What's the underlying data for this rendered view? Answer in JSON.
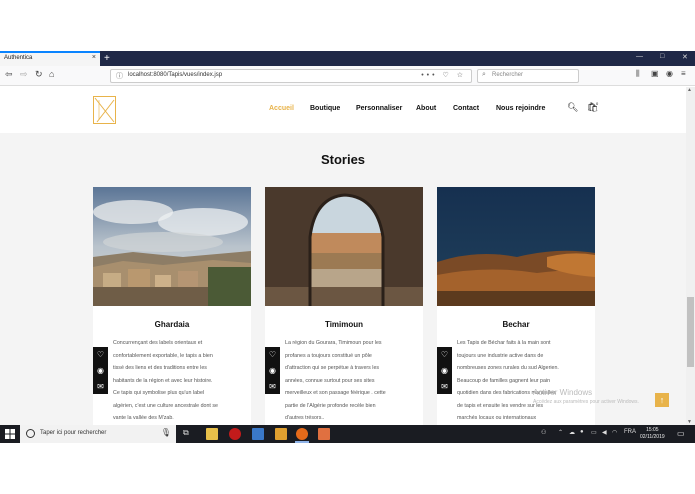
{
  "browser": {
    "tab_title": "Authentica",
    "tab_close": "×",
    "new_tab": "+",
    "window_controls": [
      "—",
      "□",
      "✕"
    ],
    "url": "localhost:8080/Tapis/vues/index.jsp",
    "url_actions": "••• ♡ ☆",
    "search_placeholder": "Rechercher"
  },
  "site": {
    "menu": [
      "Accueil",
      "Boutique",
      "Personnaliser",
      "About",
      "Contact",
      "Nous rejoindre"
    ],
    "active_menu": "Accueil",
    "cart_count": "0",
    "section_title": "Stories",
    "stories": [
      {
        "title": "Ghardaia",
        "lines": [
          "Concurrençant des labels orientaux et",
          "confortablement exportable, le tapis a bien",
          "tissé des liens et des traditions entre les",
          "habitants de la région et avec leur histoire.",
          "Ce tapis qui symbolise plus qu'un label",
          "algérien, c'est une culture ancestrale dont se",
          "vante la vallée des M'zab."
        ]
      },
      {
        "title": "Timimoun",
        "lines": [
          "La région du Gourara, Timimoun pour les",
          "profanes a toujours constitué un pôle",
          "d'attraction qui se perpétue à travers les",
          "années, connue surtout pour ses sites",
          "merveilleux et son passage féérique . cette",
          "partie de l'Algérie profonde recèle bien",
          "d'autres trésors.."
        ]
      },
      {
        "title": "Bechar",
        "lines": [
          "Les Tapis de Béchar faits à la main sont",
          "toujours une industrie active dans de",
          "nombreuses zones rurales du sud Algerien.",
          "Beaucoup de familles gagnent leur pain",
          "quotidien dans des fabrications manuelles",
          "de tapis et ensuite les vendre sur les",
          "marchés locaux ou internationaux"
        ]
      }
    ]
  },
  "windows_watermark": {
    "line1": "Activer Windows",
    "line2": "Accédez aux paramètres pour activer Windows."
  },
  "taskbar": {
    "search_text": "Taper ici pour rechercher",
    "language": "FRA",
    "time": "15:05",
    "date": "02/11/2019"
  },
  "colors": {
    "accent": "#e8b34a",
    "tabbar": "#1f2847",
    "taskbar": "#1a1c22"
  }
}
